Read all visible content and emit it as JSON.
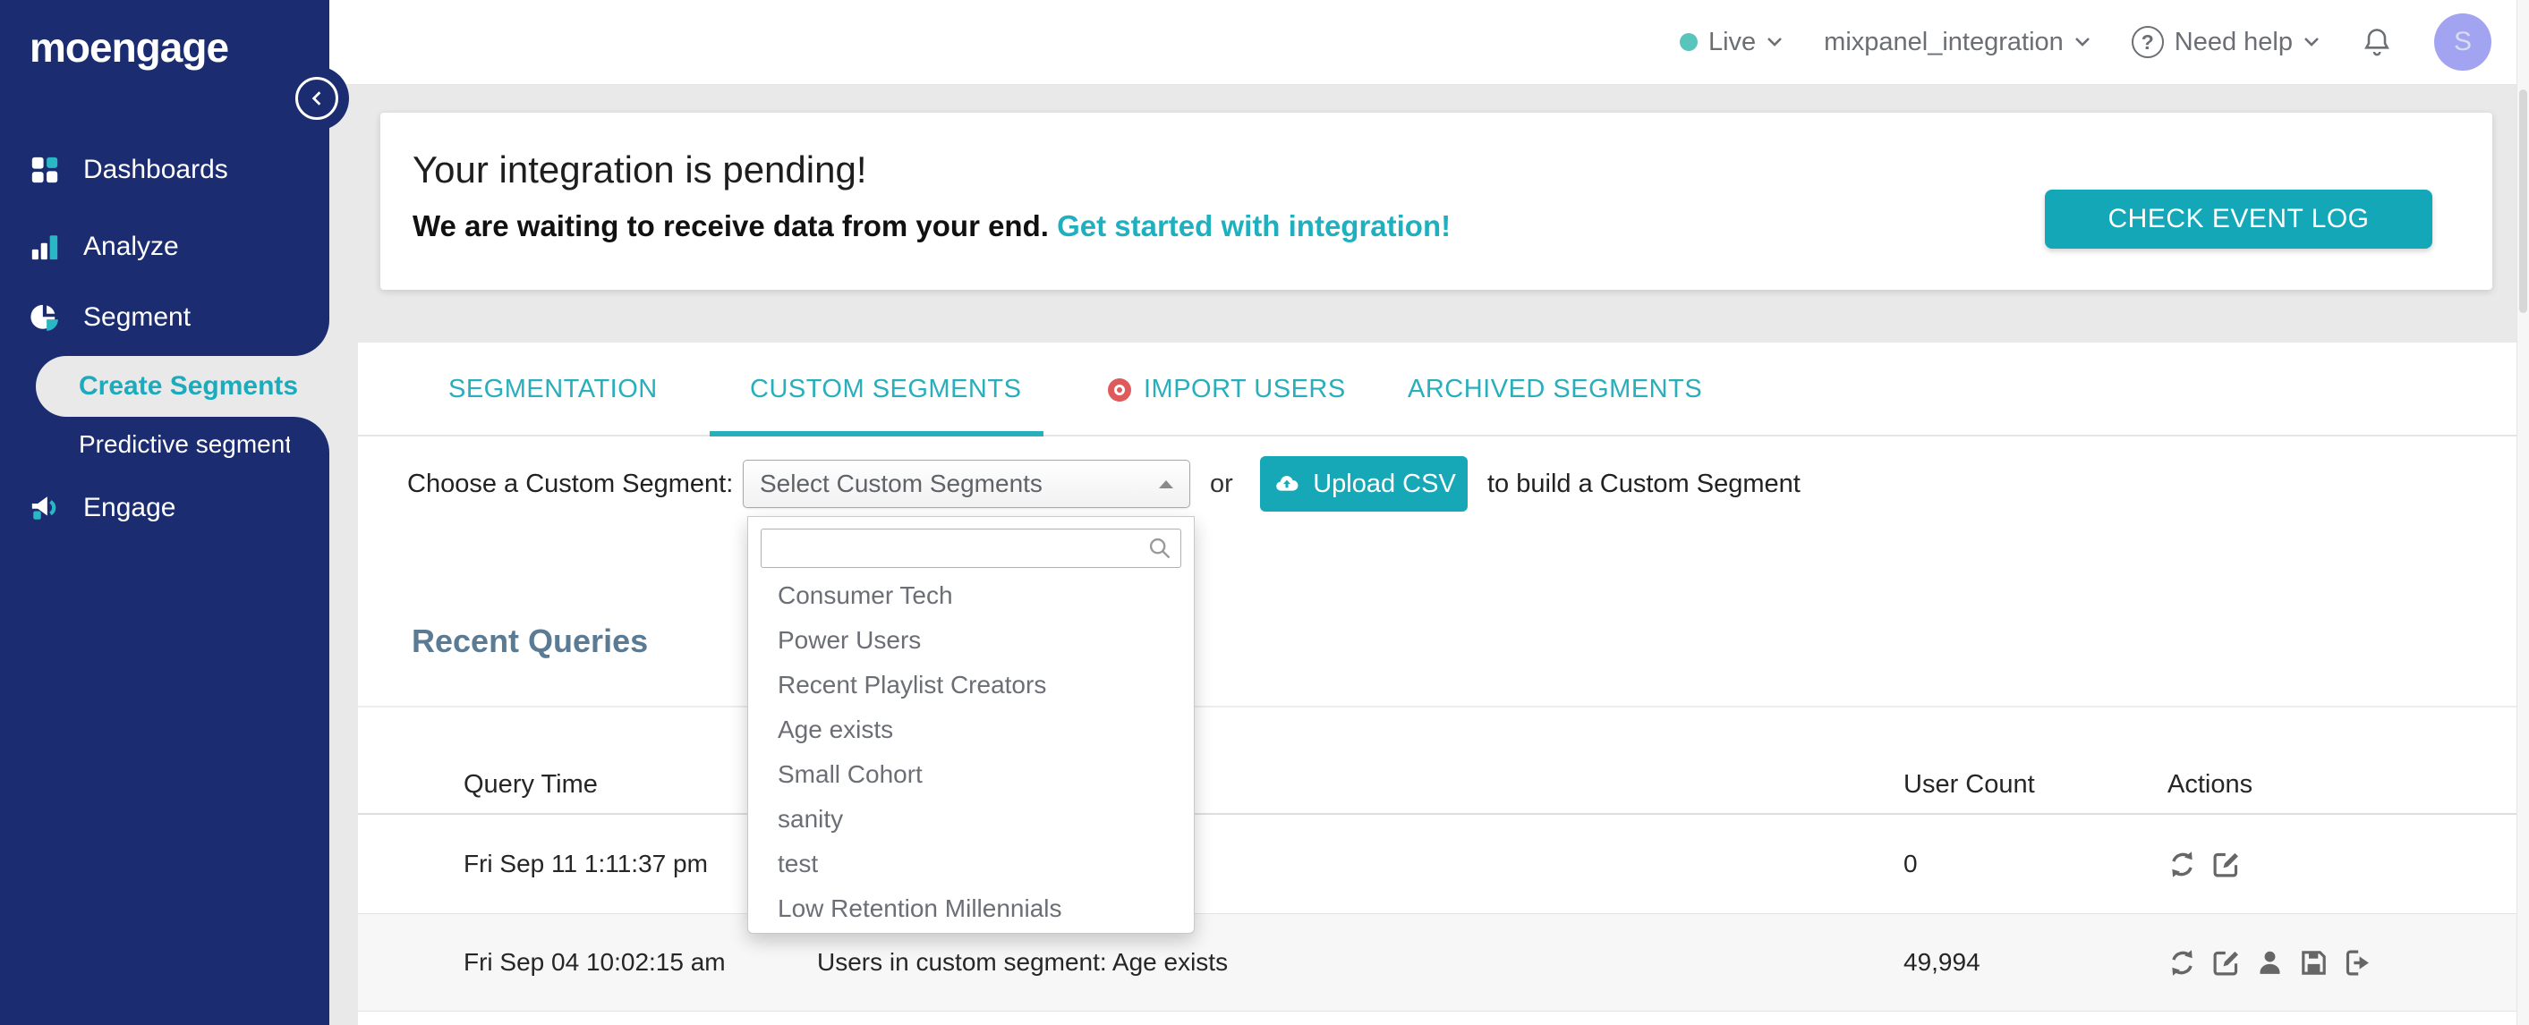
{
  "colors": {
    "navy": "#1b2d70",
    "teal": "#17a8b8",
    "page_bg": "#e9e9e9",
    "live_dot": "#59c4bc",
    "avatar_bg": "#a2a4f2",
    "import_dot": "#df5b5b",
    "heading_slate": "#5a7b93"
  },
  "sidebar": {
    "logo": "moengage",
    "items": [
      {
        "label": "Dashboards"
      },
      {
        "label": "Analyze"
      },
      {
        "label": "Segment"
      },
      {
        "label": "Create Segments",
        "active": true
      },
      {
        "label": "Predictive segments"
      },
      {
        "label": "Engage"
      }
    ]
  },
  "topbar": {
    "env_label": "Live",
    "workspace": "mixpanel_integration",
    "help_label": "Need help",
    "avatar_initial": "S"
  },
  "banner": {
    "title": "Your integration is pending!",
    "subtitle": "We are waiting to receive data from your end.",
    "link_label": "Get started with integration!",
    "button_label": "CHECK EVENT LOG"
  },
  "tabs": {
    "items": [
      "SEGMENTATION",
      "CUSTOM SEGMENTS",
      "IMPORT USERS",
      "ARCHIVED SEGMENTS"
    ],
    "active": "CUSTOM SEGMENTS"
  },
  "segment_picker": {
    "label": "Choose a Custom Segment:",
    "select_value": "Select Custom Segments",
    "or_text": "or",
    "upload_button": "Upload CSV",
    "suffix_text": "to build a Custom Segment",
    "search_value": "",
    "search_placeholder": "",
    "options": [
      "Consumer Tech",
      "Power Users",
      "Recent Playlist Creators",
      "Age exists",
      "Small Cohort",
      "sanity",
      "test",
      "Low Retention Millennials"
    ]
  },
  "recent_queries": {
    "title": "Recent Queries",
    "columns": {
      "time": "Query Time",
      "count": "User Count",
      "actions": "Actions"
    },
    "rows": [
      {
        "query_time": "Fri Sep 11 1:11:37 pm",
        "query": "",
        "user_count": "0",
        "actions": [
          "refresh",
          "edit"
        ]
      },
      {
        "query_time": "Fri Sep 04 10:02:15 am",
        "query": "Users in custom segment: Age exists",
        "user_count": "49,994",
        "actions": [
          "refresh",
          "edit",
          "user",
          "save",
          "export"
        ]
      }
    ]
  }
}
